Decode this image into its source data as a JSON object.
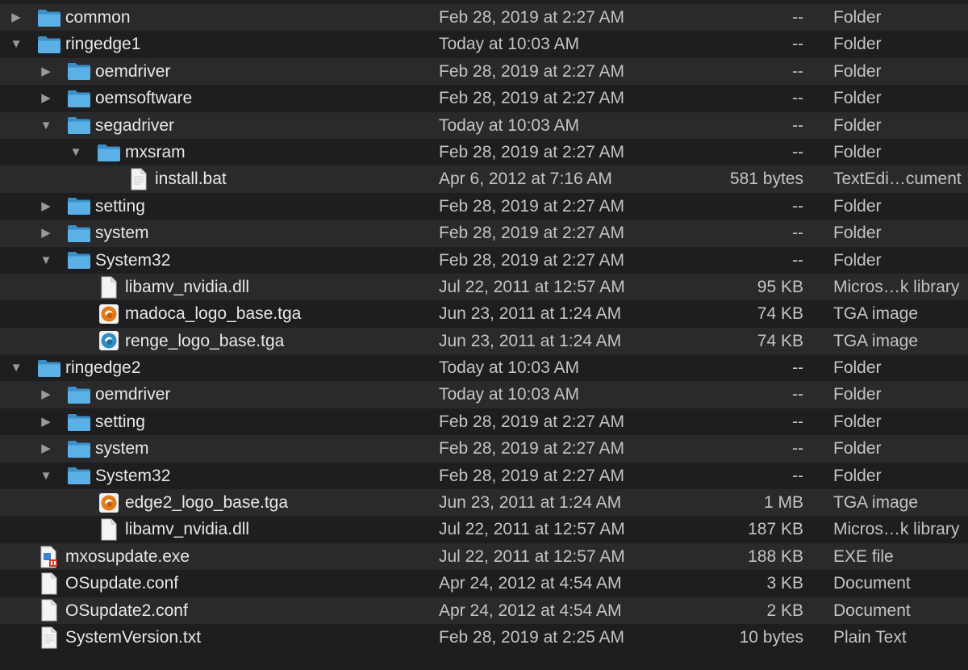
{
  "rows": [
    {
      "name": "common",
      "date": "Feb 28, 2019 at 2:27 AM",
      "size": "--",
      "kind": "Folder",
      "depth": 0,
      "disclosure": "right",
      "icon": "folder-icon"
    },
    {
      "name": "ringedge1",
      "date": "Today at 10:03 AM",
      "size": "--",
      "kind": "Folder",
      "depth": 0,
      "disclosure": "down",
      "icon": "folder-icon"
    },
    {
      "name": "oemdriver",
      "date": "Feb 28, 2019 at 2:27 AM",
      "size": "--",
      "kind": "Folder",
      "depth": 1,
      "disclosure": "right",
      "icon": "folder-icon"
    },
    {
      "name": "oemsoftware",
      "date": "Feb 28, 2019 at 2:27 AM",
      "size": "--",
      "kind": "Folder",
      "depth": 1,
      "disclosure": "right",
      "icon": "folder-icon"
    },
    {
      "name": "segadriver",
      "date": "Today at 10:03 AM",
      "size": "--",
      "kind": "Folder",
      "depth": 1,
      "disclosure": "down",
      "icon": "folder-icon"
    },
    {
      "name": "mxsram",
      "date": "Feb 28, 2019 at 2:27 AM",
      "size": "--",
      "kind": "Folder",
      "depth": 2,
      "disclosure": "down",
      "icon": "folder-icon"
    },
    {
      "name": "install.bat",
      "date": "Apr 6, 2012 at 7:16 AM",
      "size": "581 bytes",
      "kind": "TextEdi…cument",
      "depth": 3,
      "disclosure": "none",
      "icon": "text-document-icon"
    },
    {
      "name": "setting",
      "date": "Feb 28, 2019 at 2:27 AM",
      "size": "--",
      "kind": "Folder",
      "depth": 1,
      "disclosure": "right",
      "icon": "folder-icon"
    },
    {
      "name": "system",
      "date": "Feb 28, 2019 at 2:27 AM",
      "size": "--",
      "kind": "Folder",
      "depth": 1,
      "disclosure": "right",
      "icon": "folder-icon"
    },
    {
      "name": "System32",
      "date": "Feb 28, 2019 at 2:27 AM",
      "size": "--",
      "kind": "Folder",
      "depth": 1,
      "disclosure": "down",
      "icon": "folder-icon"
    },
    {
      "name": "libamv_nvidia.dll",
      "date": "Jul 22, 2011 at 12:57 AM",
      "size": "95 KB",
      "kind": "Micros…k library",
      "depth": 2,
      "disclosure": "none",
      "icon": "document-icon"
    },
    {
      "name": "madoca_logo_base.tga",
      "date": "Jun 23, 2011 at 1:24 AM",
      "size": "74 KB",
      "kind": "TGA image",
      "depth": 2,
      "disclosure": "none",
      "icon": "orange-logo-icon"
    },
    {
      "name": "renge_logo_base.tga",
      "date": "Jun 23, 2011 at 1:24 AM",
      "size": "74 KB",
      "kind": "TGA image",
      "depth": 2,
      "disclosure": "none",
      "icon": "blue-logo-icon"
    },
    {
      "name": "ringedge2",
      "date": "Today at 10:03 AM",
      "size": "--",
      "kind": "Folder",
      "depth": 0,
      "disclosure": "down",
      "icon": "folder-icon"
    },
    {
      "name": "oemdriver",
      "date": "Today at 10:03 AM",
      "size": "--",
      "kind": "Folder",
      "depth": 1,
      "disclosure": "right",
      "icon": "folder-icon"
    },
    {
      "name": "setting",
      "date": "Feb 28, 2019 at 2:27 AM",
      "size": "--",
      "kind": "Folder",
      "depth": 1,
      "disclosure": "right",
      "icon": "folder-icon"
    },
    {
      "name": "system",
      "date": "Feb 28, 2019 at 2:27 AM",
      "size": "--",
      "kind": "Folder",
      "depth": 1,
      "disclosure": "right",
      "icon": "folder-icon"
    },
    {
      "name": "System32",
      "date": "Feb 28, 2019 at 2:27 AM",
      "size": "--",
      "kind": "Folder",
      "depth": 1,
      "disclosure": "down",
      "icon": "folder-icon"
    },
    {
      "name": "edge2_logo_base.tga",
      "date": "Jun 23, 2011 at 1:24 AM",
      "size": "1 MB",
      "kind": "TGA image",
      "depth": 2,
      "disclosure": "none",
      "icon": "orange-logo-icon"
    },
    {
      "name": "libamv_nvidia.dll",
      "date": "Jul 22, 2011 at 12:57 AM",
      "size": "187 KB",
      "kind": "Micros…k library",
      "depth": 2,
      "disclosure": "none",
      "icon": "document-icon"
    },
    {
      "name": "mxosupdate.exe",
      "date": "Jul 22, 2011 at 12:57 AM",
      "size": "188 KB",
      "kind": "EXE file",
      "depth": 0,
      "disclosure": "none",
      "icon": "exe-file-icon"
    },
    {
      "name": "OSupdate.conf",
      "date": "Apr 24, 2012 at 4:54 AM",
      "size": "3 KB",
      "kind": "Document",
      "depth": 0,
      "disclosure": "none",
      "icon": "document-icon"
    },
    {
      "name": "OSupdate2.conf",
      "date": "Apr 24, 2012 at 4:54 AM",
      "size": "2 KB",
      "kind": "Document",
      "depth": 0,
      "disclosure": "none",
      "icon": "document-icon"
    },
    {
      "name": "SystemVersion.txt",
      "date": "Feb 28, 2019 at 2:25 AM",
      "size": "10 bytes",
      "kind": "Plain Text",
      "depth": 0,
      "disclosure": "none",
      "icon": "text-document-icon"
    }
  ],
  "colors": {
    "background": "#1e1e20",
    "row_alt": "#2a2a2c",
    "folder": "#5bb0e6",
    "text": "#e8e8e8",
    "secondary_text": "#c4c4c4"
  }
}
